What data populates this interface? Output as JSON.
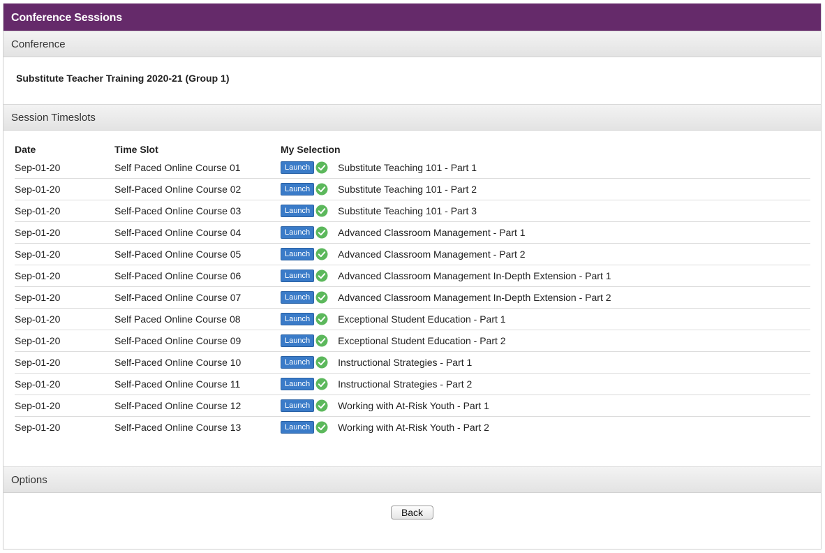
{
  "window": {
    "title": "Conference Sessions"
  },
  "conference": {
    "header": "Conference",
    "name": "Substitute Teacher Training 2020-21 (Group 1)"
  },
  "timeslots": {
    "header": "Session Timeslots",
    "columns": {
      "date": "Date",
      "slot": "Time Slot",
      "selection": "My Selection"
    },
    "launch_label": "Launch",
    "rows": [
      {
        "date": "Sep-01-20",
        "slot": "Self Paced Online Course 01",
        "selection": "Substitute Teaching 101 - Part 1"
      },
      {
        "date": "Sep-01-20",
        "slot": "Self-Paced Online Course 02",
        "selection": "Substitute Teaching 101 - Part 2"
      },
      {
        "date": "Sep-01-20",
        "slot": "Self-Paced Online Course 03",
        "selection": "Substitute Teaching 101 - Part 3"
      },
      {
        "date": "Sep-01-20",
        "slot": "Self-Paced Online Course 04",
        "selection": "Advanced Classroom Management - Part 1"
      },
      {
        "date": "Sep-01-20",
        "slot": "Self-Paced Online Course 05",
        "selection": "Advanced Classroom Management - Part 2"
      },
      {
        "date": "Sep-01-20",
        "slot": "Self-Paced Online Course 06",
        "selection": "Advanced Classroom Management In-Depth Extension - Part 1"
      },
      {
        "date": "Sep-01-20",
        "slot": "Self-Paced Online Course 07",
        "selection": "Advanced Classroom Management In-Depth Extension - Part 2"
      },
      {
        "date": "Sep-01-20",
        "slot": "Self Paced Online Course 08",
        "selection": "Exceptional Student Education - Part 1"
      },
      {
        "date": "Sep-01-20",
        "slot": "Self-Paced Online Course 09",
        "selection": "Exceptional Student Education - Part 2"
      },
      {
        "date": "Sep-01-20",
        "slot": "Self-Paced Online Course 10",
        "selection": "Instructional Strategies - Part 1"
      },
      {
        "date": "Sep-01-20",
        "slot": "Self-Paced Online Course 11",
        "selection": "Instructional Strategies - Part 2"
      },
      {
        "date": "Sep-01-20",
        "slot": "Self-Paced Online Course 12",
        "selection": "Working with At-Risk Youth - Part 1"
      },
      {
        "date": "Sep-01-20",
        "slot": "Self-Paced Online Course 13",
        "selection": "Working with At-Risk Youth - Part 2"
      }
    ]
  },
  "options": {
    "header": "Options",
    "back_label": "Back"
  },
  "icons": {
    "selected": "check-circle-icon"
  },
  "colors": {
    "titlebar": "#652a6a",
    "launch": "#3a7bc8",
    "check": "#5cb85c"
  }
}
